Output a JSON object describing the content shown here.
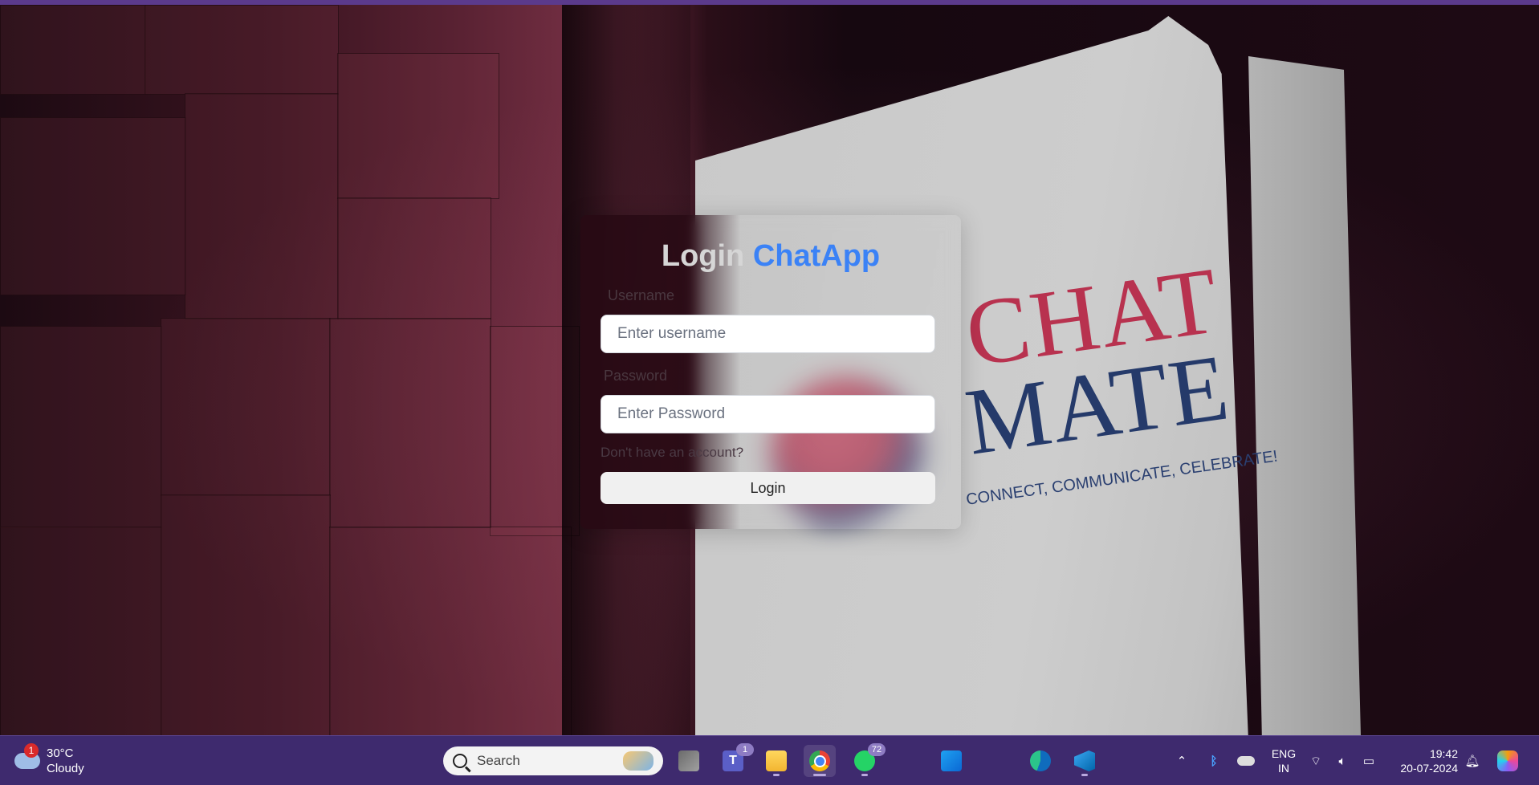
{
  "login": {
    "title_prefix": "Login",
    "title_brand": "ChatApp",
    "username_label": "Username",
    "username_placeholder": "Enter username",
    "password_label": "Password",
    "password_placeholder": "Enter Password",
    "signup_link": "Don't have an account?",
    "login_button": "Login"
  },
  "background_sign": {
    "line1": "CHAT",
    "line2": "MATE",
    "tagline": "CONNECT, COMMUNICATE, CELEBRATE!"
  },
  "taskbar": {
    "weather": {
      "temp": "30°C",
      "condition": "Cloudy",
      "alert_count": "1",
      "icon": "cloud-icon"
    },
    "search_placeholder": "Search",
    "apps": [
      {
        "name": "task-view",
        "icon": "task-view-icon"
      },
      {
        "name": "teams",
        "icon": "teams-icon",
        "badge": "1"
      },
      {
        "name": "file-explorer",
        "icon": "folder-icon"
      },
      {
        "name": "chrome",
        "icon": "chrome-icon",
        "active": true
      },
      {
        "name": "whatsapp",
        "icon": "whatsapp-icon",
        "badge": "72"
      },
      {
        "name": "store",
        "icon": "store-icon"
      },
      {
        "name": "edge",
        "icon": "edge-icon"
      },
      {
        "name": "vscode",
        "icon": "vscode-icon"
      }
    ],
    "lang_line1": "ENG",
    "lang_line2": "IN",
    "time": "19:42",
    "date": "20-07-2024"
  },
  "colors": {
    "brand_blue": "#3b82f6",
    "taskbar_bg": "#3e2a6e",
    "sign_red": "#b8324f",
    "sign_navy": "#253a6a"
  }
}
